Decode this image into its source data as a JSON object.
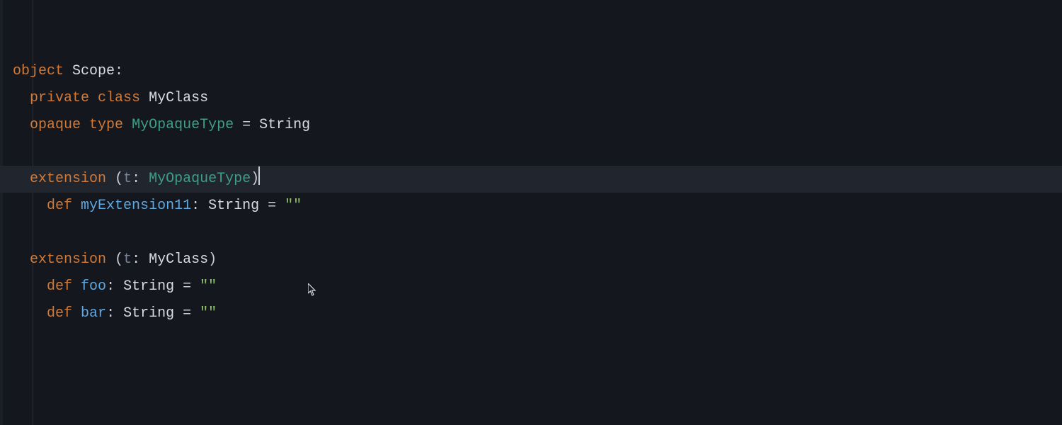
{
  "colors": {
    "background": "#14171d",
    "highlight_line_bg": "#21252d",
    "keyword": "#d07a3a",
    "type_ref": "#3f9e8b",
    "identifier": "#d9dce3",
    "param_dim": "#7b8496",
    "method": "#5fa8e0",
    "punct": "#c9cdd5",
    "string": "#8fbf6e"
  },
  "cursor_line_index": 4,
  "lines": [
    {
      "indent": 0,
      "tokens": [
        {
          "t": "object",
          "c": "kw"
        },
        {
          "t": " ",
          "c": "punct"
        },
        {
          "t": "Scope",
          "c": "id-type"
        },
        {
          "t": ":",
          "c": "punct"
        }
      ]
    },
    {
      "indent": 1,
      "tokens": [
        {
          "t": "private",
          "c": "kw"
        },
        {
          "t": " ",
          "c": "punct"
        },
        {
          "t": "class",
          "c": "kw"
        },
        {
          "t": " ",
          "c": "punct"
        },
        {
          "t": "MyClass",
          "c": "id-type"
        }
      ]
    },
    {
      "indent": 1,
      "tokens": [
        {
          "t": "opaque",
          "c": "kw"
        },
        {
          "t": " ",
          "c": "punct"
        },
        {
          "t": "type",
          "c": "kw"
        },
        {
          "t": " ",
          "c": "punct"
        },
        {
          "t": "MyOpaqueType",
          "c": "opaque-type"
        },
        {
          "t": " = ",
          "c": "op"
        },
        {
          "t": "String",
          "c": "id-type"
        }
      ]
    },
    {
      "indent": 0,
      "tokens": []
    },
    {
      "indent": 1,
      "highlighted": true,
      "cursor_after": true,
      "tokens": [
        {
          "t": "extension",
          "c": "kw"
        },
        {
          "t": " (",
          "c": "punct"
        },
        {
          "t": "t",
          "c": "param-name"
        },
        {
          "t": ": ",
          "c": "punct"
        },
        {
          "t": "MyOpaqueType",
          "c": "opaque-type"
        },
        {
          "t": ")",
          "c": "punct"
        }
      ]
    },
    {
      "indent": 2,
      "tokens": [
        {
          "t": "def",
          "c": "kw"
        },
        {
          "t": " ",
          "c": "punct"
        },
        {
          "t": "myExtension11",
          "c": "method"
        },
        {
          "t": ": ",
          "c": "punct"
        },
        {
          "t": "String",
          "c": "id-type"
        },
        {
          "t": " = ",
          "c": "op"
        },
        {
          "t": "\"\"",
          "c": "string"
        }
      ]
    },
    {
      "indent": 0,
      "tokens": []
    },
    {
      "indent": 1,
      "tokens": [
        {
          "t": "extension",
          "c": "kw"
        },
        {
          "t": " (",
          "c": "punct"
        },
        {
          "t": "t",
          "c": "param-name"
        },
        {
          "t": ": ",
          "c": "punct"
        },
        {
          "t": "MyClass",
          "c": "id-type"
        },
        {
          "t": ")",
          "c": "punct"
        }
      ]
    },
    {
      "indent": 2,
      "tokens": [
        {
          "t": "def",
          "c": "kw"
        },
        {
          "t": " ",
          "c": "punct"
        },
        {
          "t": "foo",
          "c": "method"
        },
        {
          "t": ": ",
          "c": "punct"
        },
        {
          "t": "String",
          "c": "id-type"
        },
        {
          "t": " = ",
          "c": "op"
        },
        {
          "t": "\"\"",
          "c": "string"
        }
      ]
    },
    {
      "indent": 2,
      "tokens": [
        {
          "t": "def",
          "c": "kw"
        },
        {
          "t": " ",
          "c": "punct"
        },
        {
          "t": "bar",
          "c": "method"
        },
        {
          "t": ": ",
          "c": "punct"
        },
        {
          "t": "String",
          "c": "id-type"
        },
        {
          "t": " = ",
          "c": "op"
        },
        {
          "t": "\"\"",
          "c": "string"
        }
      ]
    },
    {
      "indent": 0,
      "tokens": []
    }
  ]
}
